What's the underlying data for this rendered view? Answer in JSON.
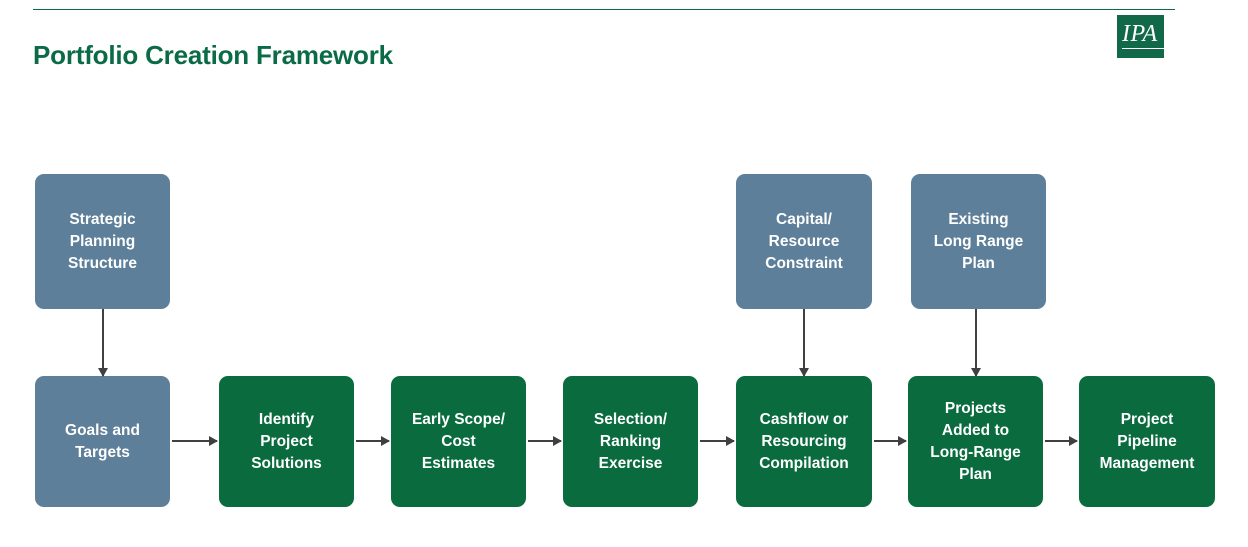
{
  "header": {
    "title": "Portfolio Creation Framework",
    "rule_color": "#10684a",
    "title_color": "#0b6b47"
  },
  "logo": {
    "name": "IPA",
    "text": "IPA",
    "background_color": "#11694a",
    "text_color": "#ffffff"
  },
  "palette": {
    "blue": "#5d7f99",
    "green": "#0a6b3e",
    "arrow": "#404040",
    "node_text": "#ffffff"
  },
  "diagram": {
    "top_row": [
      {
        "id": "strategic-planning-structure",
        "label": "Strategic\nPlanning\nStructure",
        "color": "blue"
      },
      {
        "id": "capital-resource-constraint",
        "label": "Capital/\nResource\nConstraint",
        "color": "blue"
      },
      {
        "id": "existing-long-range-plan",
        "label": "Existing\nLong Range\nPlan",
        "color": "blue"
      }
    ],
    "bottom_row": [
      {
        "id": "goals-and-targets",
        "label": "Goals  and\nTargets",
        "color": "blue"
      },
      {
        "id": "identify-project-solutions",
        "label": "Identify\nProject\nSolutions",
        "color": "green"
      },
      {
        "id": "early-scope-cost-estimates",
        "label": "Early Scope/\nCost\nEstimates",
        "color": "green"
      },
      {
        "id": "selection-ranking-exercise",
        "label": "Selection/\nRanking\nExercise",
        "color": "green"
      },
      {
        "id": "cashflow-or-resourcing-compilation",
        "label": "Cashflow or\nResourcing\nCompilation",
        "color": "green"
      },
      {
        "id": "projects-added-to-long-range-plan",
        "label": "Projects\nAdded to\nLong-Range\nPlan",
        "color": "green"
      },
      {
        "id": "project-pipeline-management",
        "label": "Project\nPipeline\nManagement",
        "color": "green"
      }
    ],
    "connectors": [
      {
        "id": "strategic-planning-structure-to-goals-and-targets",
        "direction": "vertical"
      },
      {
        "id": "capital-resource-constraint-to-cashflow-or-resourcing-compilation",
        "direction": "vertical"
      },
      {
        "id": "existing-long-range-plan-to-projects-added-to-long-range-plan",
        "direction": "vertical"
      },
      {
        "id": "goals-and-targets-to-identify-project-solutions",
        "direction": "horizontal"
      },
      {
        "id": "identify-project-solutions-to-early-scope-cost-estimates",
        "direction": "horizontal"
      },
      {
        "id": "early-scope-cost-estimates-to-selection-ranking-exercise",
        "direction": "horizontal"
      },
      {
        "id": "selection-ranking-exercise-to-cashflow-or-resourcing-compilation",
        "direction": "horizontal"
      },
      {
        "id": "cashflow-or-resourcing-compilation-to-projects-added-to-long-range-plan",
        "direction": "horizontal"
      },
      {
        "id": "projects-added-to-long-range-plan-to-project-pipeline-management",
        "direction": "horizontal"
      }
    ]
  }
}
